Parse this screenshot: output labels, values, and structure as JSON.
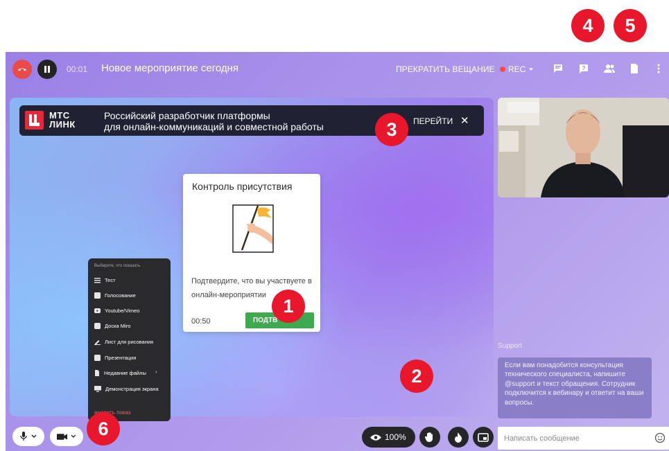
{
  "topbar": {
    "timer": "00:01",
    "title": "Новое мероприятие сегодня",
    "stop_broadcast": "ПРЕКРАТИТЬ ВЕЩАНИЕ",
    "rec": "REC",
    "icons": [
      "chat-icon",
      "question-icon",
      "participants-icon",
      "file-icon",
      "more-icon"
    ]
  },
  "banner": {
    "logo_line1": "МТС",
    "logo_line2": "ЛИНК",
    "text_line1": "Российский разработчик платформы",
    "text_line2": "для онлайн-коммуникаций и совместной работы",
    "go_label": "ПЕРЕЙТИ",
    "close_glyph": "✕"
  },
  "attendance_card": {
    "title": "Контроль присутствия",
    "text": "Подтвердите, что вы участвуете в онлайн-мероприятии",
    "timer": "00:50",
    "confirm_label": "ПОДТВ"
  },
  "show_menu": {
    "hint": "Выберите, что показать",
    "items": [
      {
        "label": "Тест",
        "icon": "list-icon"
      },
      {
        "label": "Голосование",
        "icon": "poll-icon"
      },
      {
        "label": "Youtube/Vimeo",
        "icon": "youtube-icon"
      },
      {
        "label": "Доска Miro",
        "icon": "miro-icon"
      },
      {
        "label": "Лист для рисования",
        "icon": "pencil-icon"
      },
      {
        "label": "Презентация",
        "icon": "presentation-icon"
      },
      {
        "label": "Недавние файлы",
        "icon": "file-icon"
      },
      {
        "label": "Демонстрация экрана",
        "icon": "screen-icon"
      }
    ],
    "stop_label": "ановить показ"
  },
  "support": {
    "label": "Support",
    "message": "Если вам понадобится консультация технического специалиста, напишите @support и текст обращения. Сотрудник подключится к вебинару и ответит на ваши вопросы."
  },
  "bottom": {
    "zoom": "100%",
    "chat_placeholder": "Написать сообщение"
  },
  "markers": [
    "1",
    "2",
    "3",
    "4",
    "5",
    "6"
  ],
  "colors": {
    "accent_red": "#e8172c",
    "confirm_green": "#3fa94f",
    "end_call": "#e94b4b",
    "banner_bg": "#1f2233"
  }
}
